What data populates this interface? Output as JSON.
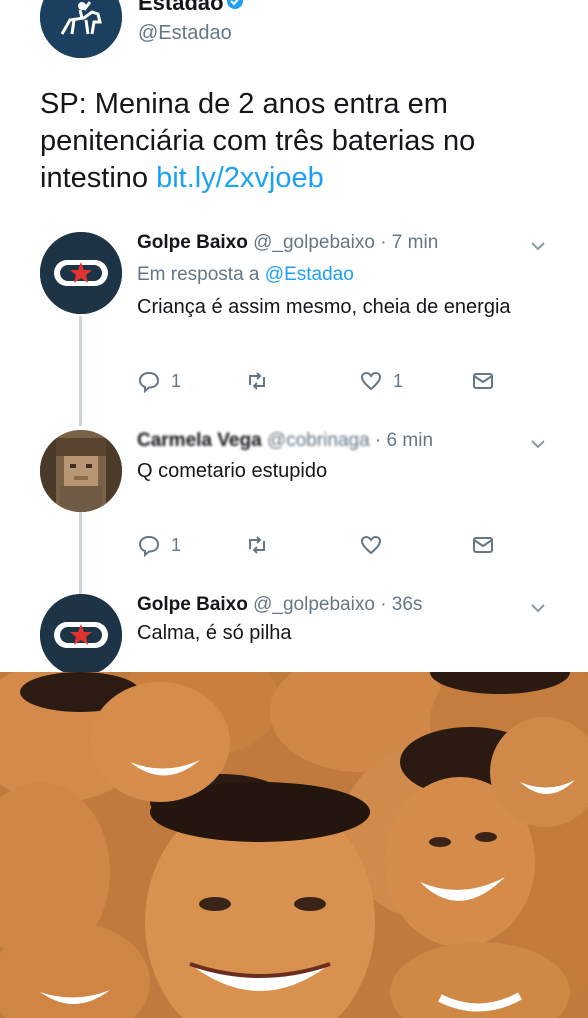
{
  "account": {
    "name": "Estadão",
    "handle": "@Estadao"
  },
  "tweet": {
    "text": "SP: Menina de 2 anos entra em penitenciária com três baterias no intestino",
    "link": "bit.ly/2xvjoeb"
  },
  "replies": [
    {
      "name": "Golpe Baixo",
      "handle": "@_golpebaixo",
      "time": "· 7 min",
      "in_reply_prefix": "Em resposta a",
      "in_reply_mention": "@Estadao",
      "text": "Criança é assim mesmo, cheia de energia",
      "reply_count": "1",
      "like_count": "1"
    },
    {
      "name": "Carmela Vega",
      "handle": "@cobrinaga",
      "time": "· 6 min",
      "text": "Q cometario estupido",
      "reply_count": "1"
    },
    {
      "name": "Golpe Baixo",
      "handle": "@_golpebaixo",
      "time": "· 36s",
      "text": "Calma, é só pilha"
    }
  ],
  "colors": {
    "link": "#1da1f2",
    "secondary_text": "#657786",
    "thread_line": "#cdd6dd"
  }
}
